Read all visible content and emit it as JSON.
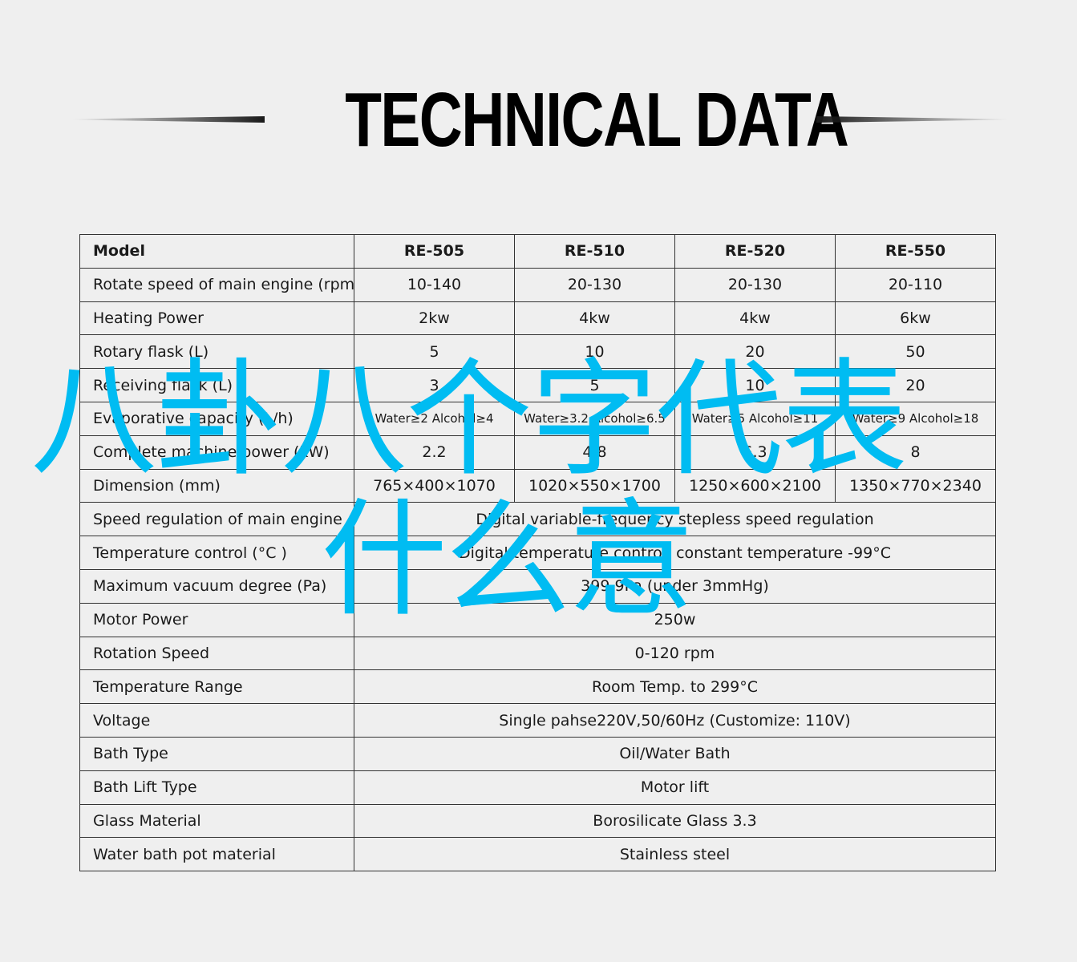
{
  "header": {
    "title": "TECHNICAL DATA"
  },
  "table": {
    "header_row": {
      "label": "Model",
      "models": [
        "RE-505",
        "RE-510",
        "RE-520",
        "RE-550"
      ]
    },
    "per_model_rows": [
      {
        "label": "Rotate speed of main engine (rpm)",
        "values": [
          "10-140",
          "20-130",
          "20-130",
          "20-110"
        ]
      },
      {
        "label": "Heating Power",
        "values": [
          "2kw",
          "4kw",
          "4kw",
          "6kw"
        ]
      },
      {
        "label": "Rotary flask (L)",
        "values": [
          "5",
          "10",
          "20",
          "50"
        ]
      },
      {
        "label": "Receiving flask (L)",
        "values": [
          "3",
          "5",
          "10",
          "20"
        ]
      },
      {
        "label": "Evaporative capacity (L/h)",
        "values": [
          "Water≥2 Alcohol≥4",
          "Water≥3.2 Alcohol≥6.5",
          "Water≥5 Alcohol≥11",
          "Water≥9 Alcohol≥18"
        ]
      },
      {
        "label": "Complete machine power (kW)",
        "values": [
          "2.2",
          "4.8",
          "6.3",
          "8"
        ]
      },
      {
        "label": "Dimension (mm)",
        "values": [
          "765×400×1070",
          "1020×550×1700",
          "1250×600×2100",
          "1350×770×2340"
        ]
      }
    ],
    "shared_rows": [
      {
        "label": "Speed regulation of main engine",
        "value": "Digital variable-frequency stepless speed regulation"
      },
      {
        "label": "Temperature control (°C )",
        "value": "Digital temperature control, constant temperature -99°C"
      },
      {
        "label": "Maximum vacuum degree (Pa)",
        "value": "399.9Pa (under 3mmHg)"
      },
      {
        "label": "Motor Power",
        "value": "250w"
      },
      {
        "label": "Rotation Speed",
        "value": "0-120 rpm"
      },
      {
        "label": "Temperature Range",
        "value": "Room Temp. to 299°C"
      },
      {
        "label": "Voltage",
        "value": "Single pahse220V,50/60Hz (Customize: 110V)"
      },
      {
        "label": "Bath Type",
        "value": "Oil/Water Bath"
      },
      {
        "label": "Bath Lift Type",
        "value": "Motor lift"
      },
      {
        "label": "Glass Material",
        "value": "Borosilicate Glass 3.3"
      },
      {
        "label": "Water bath pot material",
        "value": "Stainless steel"
      }
    ]
  },
  "overlay": {
    "line1": "八卦八个字代表",
    "line2": "什么意",
    "color": "#00bcf2"
  },
  "colors": {
    "background": "#efefef",
    "border": "#333333",
    "text": "#1a1a1a"
  }
}
